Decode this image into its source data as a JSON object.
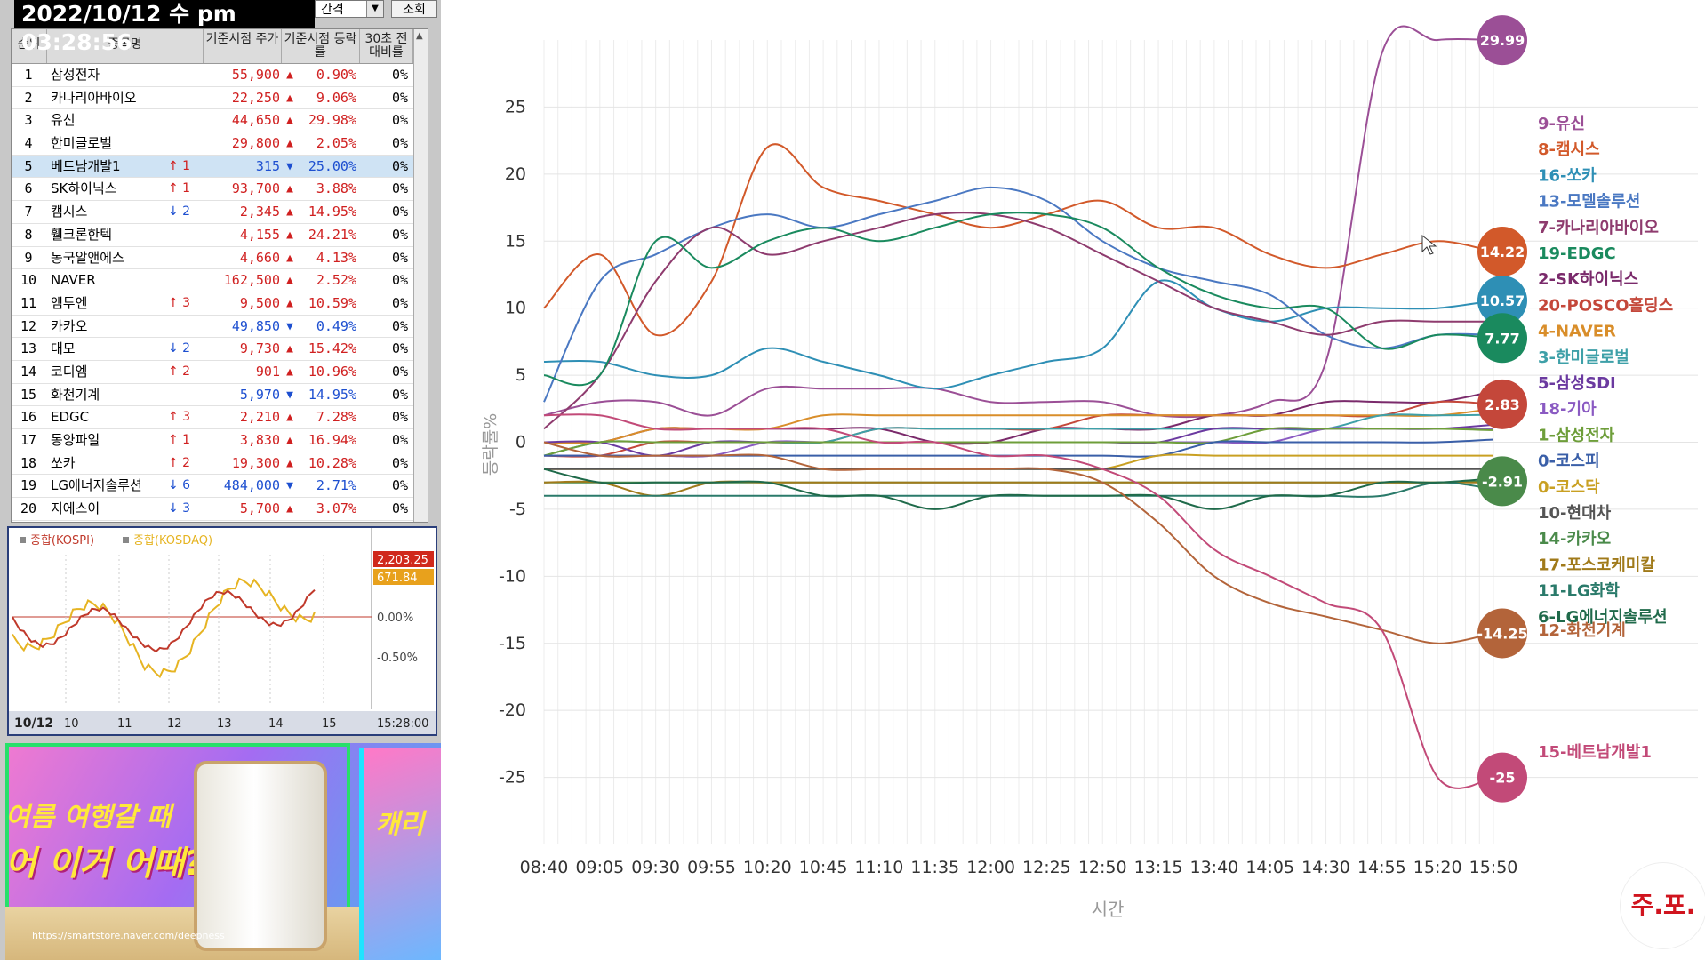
{
  "clock": "2022/10/12 수 pm 03:28:56",
  "controls": {
    "interval_label": "간격",
    "query_button": "조회"
  },
  "table": {
    "headers": {
      "rank": "순위",
      "name": "종목명",
      "price": "기준시점 주가",
      "rate": "기준시점 등락률",
      "cmp": "30초 전 대비률"
    },
    "rows": [
      {
        "rank": "1",
        "name": "삼성전자",
        "chg": "",
        "price": "55,900",
        "dir": "▲",
        "rate": "0.90%",
        "cmp": "0%"
      },
      {
        "rank": "2",
        "name": "카나리아바이오",
        "chg": "",
        "price": "22,250",
        "dir": "▲",
        "rate": "9.06%",
        "cmp": "0%"
      },
      {
        "rank": "3",
        "name": "유신",
        "chg": "",
        "price": "44,650",
        "dir": "▲",
        "rate": "29.98%",
        "cmp": "0%"
      },
      {
        "rank": "4",
        "name": "한미글로벌",
        "chg": "",
        "price": "29,800",
        "dir": "▲",
        "rate": "2.05%",
        "cmp": "0%"
      },
      {
        "rank": "5",
        "name": "베트남개발1",
        "chg": "↑ 1",
        "price": "315",
        "dir": "▼",
        "rate": "25.00%",
        "cmp": "0%",
        "highlight": true
      },
      {
        "rank": "6",
        "name": "SK하이닉스",
        "chg": "↑ 1",
        "price": "93,700",
        "dir": "▲",
        "rate": "3.88%",
        "cmp": "0%"
      },
      {
        "rank": "7",
        "name": "캠시스",
        "chg": "↓ 2",
        "price": "2,345",
        "dir": "▲",
        "rate": "14.95%",
        "cmp": "0%"
      },
      {
        "rank": "8",
        "name": "휄크론한텍",
        "chg": "",
        "price": "4,155",
        "dir": "▲",
        "rate": "24.21%",
        "cmp": "0%"
      },
      {
        "rank": "9",
        "name": "동국알앤에스",
        "chg": "",
        "price": "4,660",
        "dir": "▲",
        "rate": "4.13%",
        "cmp": "0%"
      },
      {
        "rank": "10",
        "name": "NAVER",
        "chg": "",
        "price": "162,500",
        "dir": "▲",
        "rate": "2.52%",
        "cmp": "0%"
      },
      {
        "rank": "11",
        "name": "엠투엔",
        "chg": "↑ 3",
        "price": "9,500",
        "dir": "▲",
        "rate": "10.59%",
        "cmp": "0%"
      },
      {
        "rank": "12",
        "name": "카카오",
        "chg": "",
        "price": "49,850",
        "dir": "▼",
        "rate": "0.49%",
        "cmp": "0%"
      },
      {
        "rank": "13",
        "name": "대모",
        "chg": "↓ 2",
        "price": "9,730",
        "dir": "▲",
        "rate": "15.42%",
        "cmp": "0%"
      },
      {
        "rank": "14",
        "name": "코디엠",
        "chg": "↑ 2",
        "price": "901",
        "dir": "▲",
        "rate": "10.96%",
        "cmp": "0%"
      },
      {
        "rank": "15",
        "name": "화천기계",
        "chg": "",
        "price": "5,970",
        "dir": "▼",
        "rate": "14.95%",
        "cmp": "0%"
      },
      {
        "rank": "16",
        "name": "EDGC",
        "chg": "↑ 3",
        "price": "2,210",
        "dir": "▲",
        "rate": "7.28%",
        "cmp": "0%"
      },
      {
        "rank": "17",
        "name": "동양파일",
        "chg": "↑ 1",
        "price": "3,830",
        "dir": "▲",
        "rate": "16.94%",
        "cmp": "0%"
      },
      {
        "rank": "18",
        "name": "쏘카",
        "chg": "↑ 2",
        "price": "19,300",
        "dir": "▲",
        "rate": "10.28%",
        "cmp": "0%"
      },
      {
        "rank": "19",
        "name": "LG에너지솔루션",
        "chg": "↓ 6",
        "price": "484,000",
        "dir": "▼",
        "rate": "2.71%",
        "cmp": "0%"
      },
      {
        "rank": "20",
        "name": "지에스이",
        "chg": "↓ 3",
        "price": "5,700",
        "dir": "▲",
        "rate": "3.07%",
        "cmp": "0%"
      }
    ]
  },
  "mini_chart": {
    "legend": [
      "종합(KOSPI)",
      "종합(KOSDAQ)"
    ],
    "kospi_color": "#c0392b",
    "kosdaq_color": "#e6b422",
    "kospi_value": "2,203.25",
    "kosdaq_value": "671.84",
    "right_ticks": [
      "0.00%",
      "-0.50%"
    ],
    "date_label": "10/12",
    "hours": [
      "10",
      "11",
      "12",
      "13",
      "14",
      "15"
    ],
    "time_label": "15:28:00"
  },
  "banner": {
    "headline1": "여름 여행갈 때",
    "headline2": "어 이거 어때?",
    "url": "https://smartstore.naver.com/deepness",
    "panel2_text": "캐리"
  },
  "chart_data": {
    "type": "line",
    "xlabel": "시간",
    "ylabel": "등락률%",
    "ylim": [
      -30,
      30
    ],
    "yticks": [
      25,
      20,
      15,
      10,
      5,
      0,
      -5,
      -10,
      -15,
      -20,
      -25
    ],
    "x": [
      "08:40",
      "09:05",
      "09:30",
      "09:55",
      "10:20",
      "10:45",
      "11:10",
      "11:35",
      "12:00",
      "12:25",
      "12:50",
      "13:15",
      "13:40",
      "14:05",
      "14:30",
      "14:55",
      "15:20",
      "15:50"
    ],
    "series": [
      {
        "name": "9-유신",
        "color": "#9b4f96",
        "values": [
          2,
          3,
          3,
          2,
          4,
          4,
          4,
          4,
          3,
          3,
          3,
          2,
          2,
          3,
          6,
          29,
          30,
          29.99
        ],
        "bubble": "29.99"
      },
      {
        "name": "8-캠시스",
        "color": "#d2592a",
        "values": [
          10,
          14,
          8,
          12,
          22,
          19,
          18,
          17,
          16,
          17,
          18,
          16,
          16,
          14,
          13,
          14,
          15,
          14.22
        ],
        "bubble": "14.22"
      },
      {
        "name": "16-쏘카",
        "color": "#2e8fb5",
        "values": [
          6,
          6,
          5,
          5,
          7,
          6,
          5,
          4,
          5,
          6,
          7,
          12,
          10,
          9,
          10,
          10,
          10,
          10.57
        ],
        "bubble": "10.57"
      },
      {
        "name": "13-모델솔루션",
        "color": "#4a78c2",
        "values": [
          3,
          12,
          14,
          16,
          17,
          16,
          17,
          18,
          19,
          18,
          15,
          13,
          12,
          11,
          8,
          7,
          8,
          8
        ]
      },
      {
        "name": "7-카나리아바이오",
        "color": "#8e3b6e",
        "values": [
          1,
          5,
          12,
          16,
          14,
          15,
          16,
          17,
          17,
          16,
          14,
          12,
          10,
          9,
          8,
          9,
          9,
          9
        ]
      },
      {
        "name": "19-EDGC",
        "color": "#1a8a5e",
        "values": [
          5,
          5,
          15,
          13,
          15,
          16,
          15,
          16,
          17,
          17,
          16,
          13,
          11,
          10,
          10,
          7,
          8,
          7.77
        ],
        "bubble": "7.77"
      },
      {
        "name": "2-SK하이닉스",
        "color": "#7a2a6b",
        "values": [
          0,
          0,
          1,
          1,
          1,
          1,
          1,
          0,
          0,
          1,
          1,
          1,
          2,
          2,
          3,
          3,
          3,
          3.8
        ]
      },
      {
        "name": "20-POSCO홀딩스",
        "color": "#c4473a",
        "values": [
          -1,
          -1,
          0,
          0,
          0,
          0,
          1,
          1,
          1,
          1,
          2,
          2,
          2,
          2,
          2,
          2,
          3,
          2.83
        ],
        "bubble": "2.83"
      },
      {
        "name": "4-NAVER",
        "color": "#d98e2a",
        "values": [
          0,
          0,
          1,
          1,
          1,
          2,
          2,
          2,
          2,
          2,
          2,
          2,
          2,
          2,
          2,
          2,
          2,
          2.5
        ]
      },
      {
        "name": "3-한미글로벌",
        "color": "#3ea0a8",
        "values": [
          -1,
          0,
          0,
          0,
          0,
          0,
          1,
          1,
          1,
          1,
          1,
          1,
          1,
          1,
          1,
          2,
          2,
          2.05
        ]
      },
      {
        "name": "5-삼성SDI",
        "color": "#6b3aa0",
        "values": [
          0,
          0,
          -1,
          0,
          0,
          0,
          0,
          0,
          0,
          0,
          0,
          0,
          1,
          1,
          1,
          1,
          1,
          1.3
        ]
      },
      {
        "name": "18-기아",
        "color": "#8a5ac2",
        "values": [
          -1,
          -1,
          -1,
          -1,
          0,
          0,
          0,
          0,
          0,
          0,
          0,
          0,
          0,
          0,
          1,
          1,
          1,
          1
        ]
      },
      {
        "name": "1-삼성전자",
        "color": "#6e9e3a",
        "values": [
          -1,
          0,
          0,
          0,
          0,
          0,
          0,
          0,
          0,
          0,
          0,
          0,
          0,
          1,
          1,
          1,
          1,
          0.9
        ]
      },
      {
        "name": "0-코스피",
        "color": "#3a5fa8",
        "values": [
          -1,
          -1,
          -1,
          -1,
          -1,
          -1,
          -1,
          -1,
          -1,
          -1,
          -1,
          -1,
          0,
          0,
          0,
          0,
          0,
          0.2
        ]
      },
      {
        "name": "0-코스닥",
        "color": "#c9a022",
        "values": [
          -2,
          -2,
          -2,
          -2,
          -2,
          -2,
          -2,
          -2,
          -2,
          -2,
          -2,
          -1,
          -1,
          -1,
          -1,
          -1,
          -1,
          -1
        ]
      },
      {
        "name": "10-현대차",
        "color": "#555555",
        "values": [
          -2,
          -2,
          -2,
          -2,
          -2,
          -2,
          -2,
          -2,
          -2,
          -2,
          -2,
          -2,
          -2,
          -2,
          -2,
          -2,
          -2,
          -2
        ]
      },
      {
        "name": "14-카카오",
        "color": "#4a8a4a",
        "values": [
          -3,
          -3,
          -3,
          -3,
          -3,
          -3,
          -3,
          -3,
          -3,
          -3,
          -3,
          -3,
          -3,
          -3,
          -3,
          -3,
          -3,
          -2.91
        ],
        "bubble": "-2.91"
      },
      {
        "name": "17-포스코케미칼",
        "color": "#a07a1a",
        "values": [
          -3,
          -3,
          -4,
          -3,
          -3,
          -3,
          -3,
          -3,
          -3,
          -3,
          -3,
          -3,
          -3,
          -3,
          -3,
          -3,
          -3,
          -3
        ]
      },
      {
        "name": "11-LG화학",
        "color": "#2a7a6a",
        "values": [
          -4,
          -4,
          -4,
          -4,
          -4,
          -4,
          -4,
          -4,
          -4,
          -4,
          -4,
          -4,
          -4,
          -4,
          -4,
          -4,
          -3,
          -3.5
        ]
      },
      {
        "name": "6-LG에너지솔루션",
        "color": "#1f6a4a",
        "values": [
          -2,
          -3,
          -3,
          -3,
          -3,
          -4,
          -4,
          -5,
          -4,
          -4,
          -4,
          -4,
          -5,
          -4,
          -4,
          -3,
          -3,
          -2.7
        ]
      },
      {
        "name": "12-화천기계",
        "color": "#b3643a",
        "values": [
          0,
          -1,
          -1,
          -1,
          -1,
          -2,
          -2,
          -2,
          -2,
          -2,
          -3,
          -6,
          -10,
          -12,
          -13,
          -14,
          -15,
          -14.25
        ],
        "bubble": "-14.25"
      },
      {
        "name": "15-베트남개발1",
        "color": "#c24a78",
        "values": [
          2,
          2,
          1,
          1,
          1,
          1,
          0,
          0,
          -1,
          -1,
          -2,
          -4,
          -8,
          -10,
          -12,
          -14,
          -25,
          -25
        ],
        "bubble": "-25"
      }
    ]
  }
}
